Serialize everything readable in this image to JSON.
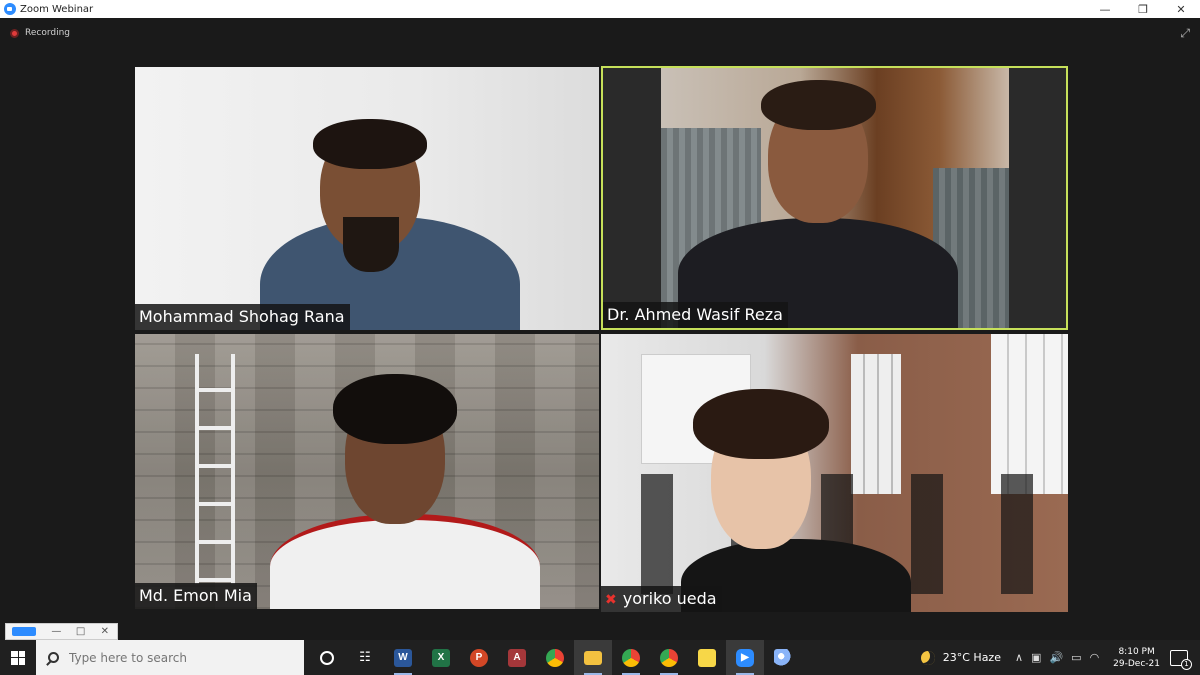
{
  "window": {
    "title": "Zoom Webinar",
    "minimize_label": "—",
    "restore_label": "❐",
    "close_label": "✕"
  },
  "meeting": {
    "recording_label": "Recording",
    "participants": [
      {
        "name": "Mohammad Shohag Rana",
        "active_speaker": false
      },
      {
        "name": "Dr. Ahmed Wasif Reza",
        "active_speaker": true
      },
      {
        "name": "Md. Emon Mia",
        "active_speaker": false
      },
      {
        "name": "yoriko ueda",
        "active_speaker": false
      }
    ],
    "active_speaker_color": "#c6e05a"
  },
  "mini_window": {
    "minimize_label": "—",
    "restore_label": "□",
    "close_label": "✕"
  },
  "taskbar": {
    "search_placeholder": "Type here to search",
    "apps": [
      {
        "icon": "task-view-icon"
      },
      {
        "icon": "widgets-icon"
      },
      {
        "icon": "word-icon",
        "color": "#2b579a",
        "letter": "W"
      },
      {
        "icon": "excel-icon",
        "color": "#217346",
        "letter": "X"
      },
      {
        "icon": "powerpoint-icon",
        "color": "#d24726",
        "letter": "P"
      },
      {
        "icon": "access-icon",
        "color": "#a4373a",
        "letter": "A"
      },
      {
        "icon": "chrome-icon"
      },
      {
        "icon": "file-explorer-icon",
        "color": "#f3c140"
      },
      {
        "icon": "chrome-profile-icon"
      },
      {
        "icon": "chrome-profile-2-icon"
      },
      {
        "icon": "sticky-notes-icon",
        "color": "#f7d748"
      },
      {
        "icon": "zoom-icon",
        "color": "#2d8cff"
      },
      {
        "icon": "paint-icon"
      }
    ],
    "weather": {
      "temp": "23°C",
      "condition": "Haze"
    },
    "clock": {
      "time": "8:10 PM",
      "date": "29-Dec-21"
    },
    "notification_count": "1"
  }
}
